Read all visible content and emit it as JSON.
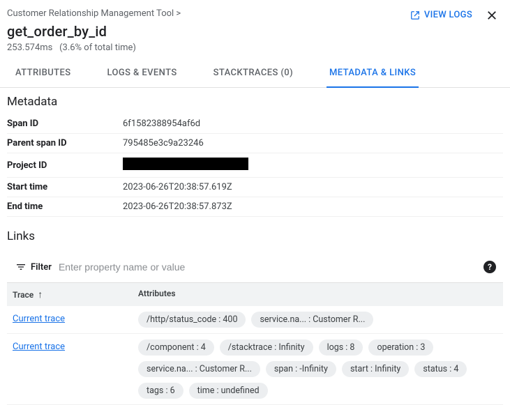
{
  "header": {
    "breadcrumb": "Customer Relationship Management Tool >",
    "view_logs": "VIEW LOGS",
    "title": "get_order_by_id",
    "duration": "253.574ms",
    "percent": "(3.6% of total time)"
  },
  "tabs": {
    "attributes": "ATTRIBUTES",
    "logs": "LOGS & EVENTS",
    "stacktraces": "STACKTRACES (0)",
    "metadata": "METADATA & LINKS"
  },
  "metadata": {
    "heading": "Metadata",
    "rows": {
      "span_id_label": "Span ID",
      "span_id_value": "6f1582388954af6d",
      "parent_span_id_label": "Parent span ID",
      "parent_span_id_value": "795485e3c9a23246",
      "project_id_label": "Project ID",
      "start_time_label": "Start time",
      "start_time_value": "2023-06-26T20:38:57.619Z",
      "end_time_label": "End time",
      "end_time_value": "2023-06-26T20:38:57.873Z"
    }
  },
  "links": {
    "heading": "Links",
    "filter_label": "Filter",
    "filter_placeholder": "Enter property name or value",
    "columns": {
      "trace": "Trace",
      "attributes": "Attributes"
    },
    "rows": [
      {
        "trace_label": "Current trace",
        "chips": [
          "/http/status_code : 400",
          "service.na... : Customer R..."
        ]
      },
      {
        "trace_label": "Current trace",
        "chips": [
          "/component : 4",
          "/stacktrace : Infinity",
          "logs : 8",
          "operation : 3",
          "service.na... : Customer R...",
          "span : -Infinity",
          "start : Infinity",
          "status : 4",
          "tags : 6",
          "time : undefined"
        ]
      }
    ]
  }
}
